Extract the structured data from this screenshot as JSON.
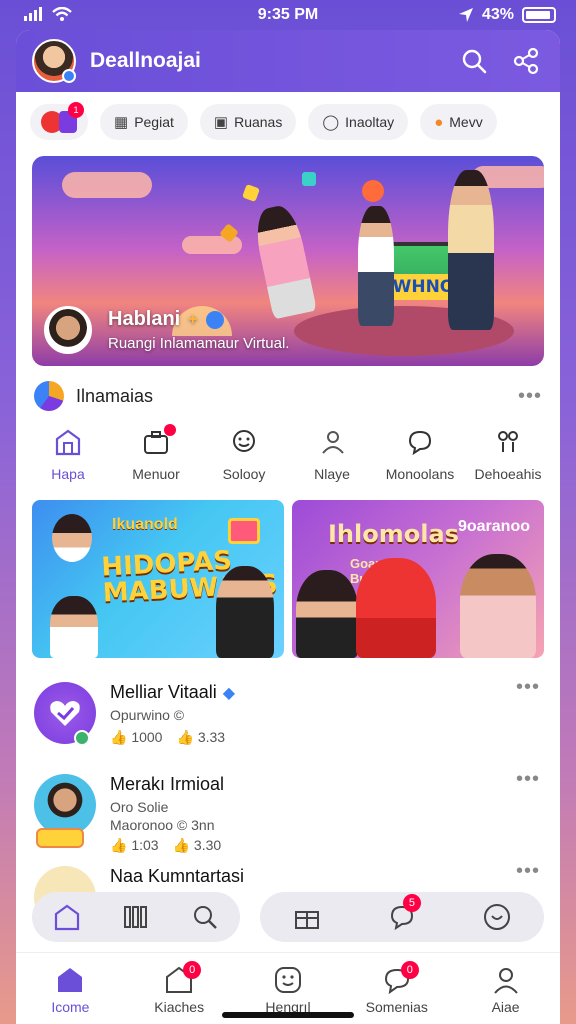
{
  "status": {
    "time": "9:35 PM",
    "battery": "43%"
  },
  "header": {
    "title": "Deallnoajai"
  },
  "chips": [
    {
      "label": "Pegiat",
      "icon": "gift-icon"
    },
    {
      "label": "Ruanas",
      "icon": "image-icon"
    },
    {
      "label": "Inaoltay",
      "icon": "chat-icon"
    },
    {
      "label": "Mevv",
      "icon": "food-icon"
    }
  ],
  "chip_badge": "1",
  "hero": {
    "board_text": "KOWHNO",
    "creator_name": "Hablani",
    "creator_sub": "Ruangi Inlamamaur Virtual."
  },
  "section": {
    "title": "Ilnamaias"
  },
  "categories": [
    {
      "label": "Hapa",
      "icon": "house-icon"
    },
    {
      "label": "Menuor",
      "icon": "briefcase-icon"
    },
    {
      "label": "Solooy",
      "icon": "smile-icon"
    },
    {
      "label": "Nlaye",
      "icon": "person-icon"
    },
    {
      "label": "Monoolans",
      "icon": "chat-bubble-icon"
    },
    {
      "label": "Dehoeahis",
      "icon": "people-icon"
    }
  ],
  "promos": [
    {
      "title": "HIDOPAS\nMABUWAHS",
      "tag": "Ikuanold"
    },
    {
      "title": "Ihlomolas",
      "tag": "9oaranoo",
      "sub": "Goaur\nBuue"
    }
  ],
  "feed": [
    {
      "name": "Melliar Vitaali",
      "sub": "Opurwino  ©",
      "stats": [
        "1000",
        "3.33"
      ]
    },
    {
      "name": "Merakı Irmioal",
      "sub": "Oro Solie",
      "sub2": "Maoronoo  © 3nn",
      "stats": [
        "1:03",
        "3.30"
      ]
    },
    {
      "name": "Naa Kumntartasi"
    }
  ],
  "floating_bar_badge": "5",
  "tabs": [
    {
      "label": "Icome",
      "icon": "home-icon"
    },
    {
      "label": "Kiaches",
      "icon": "house-outline-icon",
      "badge": "0"
    },
    {
      "label": "Hengrıl",
      "icon": "smiley-icon"
    },
    {
      "label": "Somenias",
      "icon": "message-icon",
      "badge": "0"
    },
    {
      "label": "Aiae",
      "icon": "profile-icon"
    }
  ],
  "colors": {
    "brand": "#6b4fd8",
    "badge": "#ff0044"
  }
}
